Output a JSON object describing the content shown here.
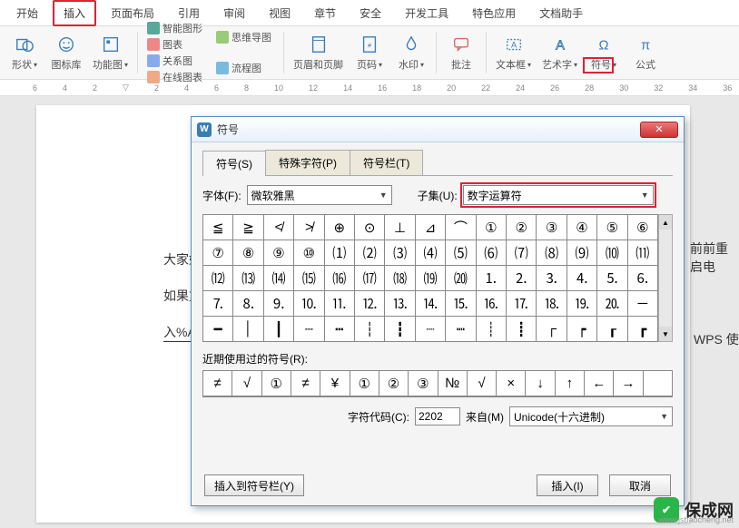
{
  "menu": {
    "items": [
      "开始",
      "插入",
      "页面布局",
      "引用",
      "审阅",
      "视图",
      "章节",
      "安全",
      "开发工具",
      "特色应用",
      "文档助手"
    ],
    "active": 1
  },
  "ribbon": {
    "shape": "形状",
    "iconlib": "图标库",
    "funcimg": "功能图",
    "smartshape": "智能图形",
    "chart": "图表",
    "mindmap": "思维导图",
    "rel": "关系图",
    "onlinechart": "在线图表",
    "flow": "流程图",
    "headerfooter": "页眉和页脚",
    "pagenum": "页码",
    "watermark": "水印",
    "comment": "批注",
    "textbox": "文本框",
    "wordart": "艺术字",
    "symbol": "符号",
    "formula": "公式"
  },
  "doc": {
    "l1": "大家好",
    "l2_a": "如果重",
    "l2_b": "前前重启电",
    "l3": "入%A",
    "l4": "WPS 使"
  },
  "dialog": {
    "title": "符号",
    "tabs": [
      "符号(S)",
      "特殊字符(P)",
      "符号栏(T)"
    ],
    "font_lbl": "字体(F):",
    "font_val": "微软雅黑",
    "subset_lbl": "子集(U):",
    "subset_val": "数字运算符",
    "grid": [
      "≦",
      "≧",
      "≮",
      "≯",
      "⊕",
      "⊙",
      "⊥",
      "⊿",
      "⌒",
      "①",
      "②",
      "③",
      "④",
      "⑤",
      "⑥",
      "⑦",
      "⑧",
      "⑨",
      "⑩",
      "⑴",
      "⑵",
      "⑶",
      "⑷",
      "⑸",
      "⑹",
      "⑺",
      "⑻",
      "⑼",
      "⑽",
      "⑾",
      "⑿",
      "⒀",
      "⒁",
      "⒂",
      "⒃",
      "⒄",
      "⒅",
      "⒆",
      "⒇",
      "⒈",
      "⒉",
      "⒊",
      "⒋",
      "⒌",
      "⒍",
      "⒎",
      "⒏",
      "⒐",
      "⒑",
      "⒒",
      "⒓",
      "⒔",
      "⒕",
      "⒖",
      "⒗",
      "⒘",
      "⒙",
      "⒚",
      "⒛",
      "─",
      "━",
      "│",
      "┃",
      "┄",
      "┅",
      "┆",
      "┇",
      "┈",
      "┉",
      "┊",
      "┋",
      "┌",
      "┍",
      "┎",
      "┏"
    ],
    "recent_lbl": "近期使用过的符号(R):",
    "recent": [
      "≠",
      "√",
      "①",
      "≠",
      "¥",
      "①",
      "②",
      "③",
      "№",
      "√",
      "×",
      "↓",
      "↑",
      "←",
      "→",
      ""
    ],
    "code_lbl": "字符代码(C):",
    "code_val": "2202",
    "from_lbl": "来自(M)",
    "from_val": "Unicode(十六进制)",
    "insert_bar": "插入到符号栏(Y)",
    "insert": "插入(I)",
    "cancel": "取消"
  },
  "brand": {
    "name": "保成网",
    "url": "www.jsbaocheng.net"
  }
}
